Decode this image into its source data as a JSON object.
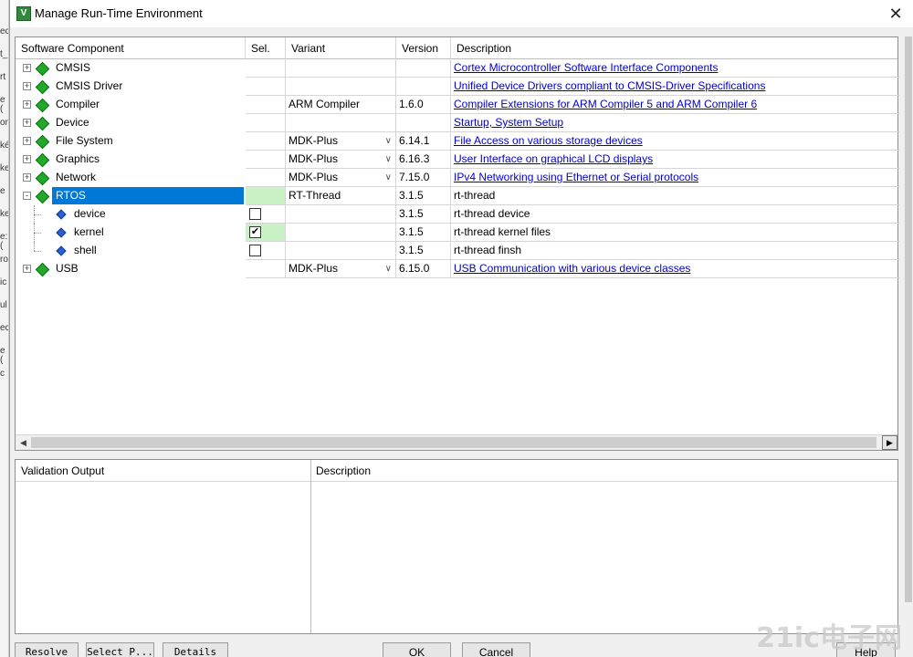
{
  "window": {
    "title": "Manage Run-Time Environment",
    "close_symbol": "✕",
    "icon_letter": "V"
  },
  "background_strip": [
    "ec",
    "t_",
    "rt",
    "e (",
    "on",
    "ké",
    "ke",
    "e",
    "ke",
    "e: (",
    "ro",
    "ic",
    "ul",
    "ec",
    "e (",
    "c"
  ],
  "columns": {
    "component": "Software Component",
    "sel": "Sel.",
    "variant": "Variant",
    "version": "Version",
    "description": "Description"
  },
  "rows": [
    {
      "name": "CMSIS",
      "level": 0,
      "expander": "+",
      "variant": "",
      "dropdown": false,
      "version": "",
      "description": "Cortex Microcontroller Software Interface Components",
      "link": true,
      "sel": "none",
      "selected": false
    },
    {
      "name": "CMSIS Driver",
      "level": 0,
      "expander": "+",
      "variant": "",
      "dropdown": false,
      "version": "",
      "description": "Unified Device Drivers compliant to CMSIS-Driver Specifications",
      "link": true,
      "sel": "none",
      "selected": false
    },
    {
      "name": "Compiler",
      "level": 0,
      "expander": "+",
      "variant": "ARM Compiler",
      "dropdown": false,
      "version": "1.6.0",
      "description": "Compiler Extensions for ARM Compiler 5 and ARM Compiler 6",
      "link": true,
      "sel": "none",
      "selected": false
    },
    {
      "name": "Device",
      "level": 0,
      "expander": "+",
      "variant": "",
      "dropdown": false,
      "version": "",
      "description": "Startup, System Setup",
      "link": true,
      "sel": "none",
      "selected": false
    },
    {
      "name": "File System",
      "level": 0,
      "expander": "+",
      "variant": "MDK-Plus",
      "dropdown": true,
      "version": "6.14.1",
      "description": "File Access on various storage devices",
      "link": true,
      "sel": "none",
      "selected": false
    },
    {
      "name": "Graphics",
      "level": 0,
      "expander": "+",
      "variant": "MDK-Plus",
      "dropdown": true,
      "version": "6.16.3",
      "description": "User Interface on graphical LCD displays",
      "link": true,
      "sel": "none",
      "selected": false
    },
    {
      "name": "Network",
      "level": 0,
      "expander": "+",
      "variant": "MDK-Plus",
      "dropdown": true,
      "version": "7.15.0",
      "description": "IPv4 Networking using Ethernet or Serial protocols",
      "link": true,
      "sel": "none",
      "selected": false
    },
    {
      "name": "RTOS",
      "level": 0,
      "expander": "-",
      "variant": "RT-Thread",
      "dropdown": false,
      "version": "3.1.5",
      "description": "rt-thread",
      "link": false,
      "sel": "green",
      "selected": true
    },
    {
      "name": "device",
      "level": 1,
      "expander": "",
      "variant": "",
      "dropdown": false,
      "version": "3.1.5",
      "description": "rt-thread device",
      "link": false,
      "sel": "unchecked",
      "selected": false
    },
    {
      "name": "kernel",
      "level": 1,
      "expander": "",
      "variant": "",
      "dropdown": false,
      "version": "3.1.5",
      "description": "rt-thread kernel files",
      "link": false,
      "sel": "checked",
      "selected": false
    },
    {
      "name": "shell",
      "level": 1,
      "expander": "",
      "variant": "",
      "dropdown": false,
      "version": "3.1.5",
      "description": "rt-thread finsh",
      "link": false,
      "sel": "unchecked",
      "selected": false
    },
    {
      "name": "USB",
      "level": 0,
      "expander": "+",
      "variant": "MDK-Plus",
      "dropdown": true,
      "version": "6.15.0",
      "description": "USB Communication with various device classes",
      "link": true,
      "sel": "none",
      "selected": false
    }
  ],
  "scrollbar": {
    "left_arrow": "◀",
    "right_arrow": "▶"
  },
  "validation": {
    "output_header": "Validation Output",
    "description_header": "Description"
  },
  "buttons": {
    "resolve": "Resolve",
    "select_packs": "Select P...",
    "details": "Details",
    "ok": "OK",
    "cancel": "Cancel",
    "help": "Help"
  },
  "watermark": "21ic电子网",
  "colors": {
    "selection_blue": "#0078d7",
    "sel_green": "#c9f2c7",
    "link_blue": "#0000cc",
    "component_green": "#22a82a"
  }
}
